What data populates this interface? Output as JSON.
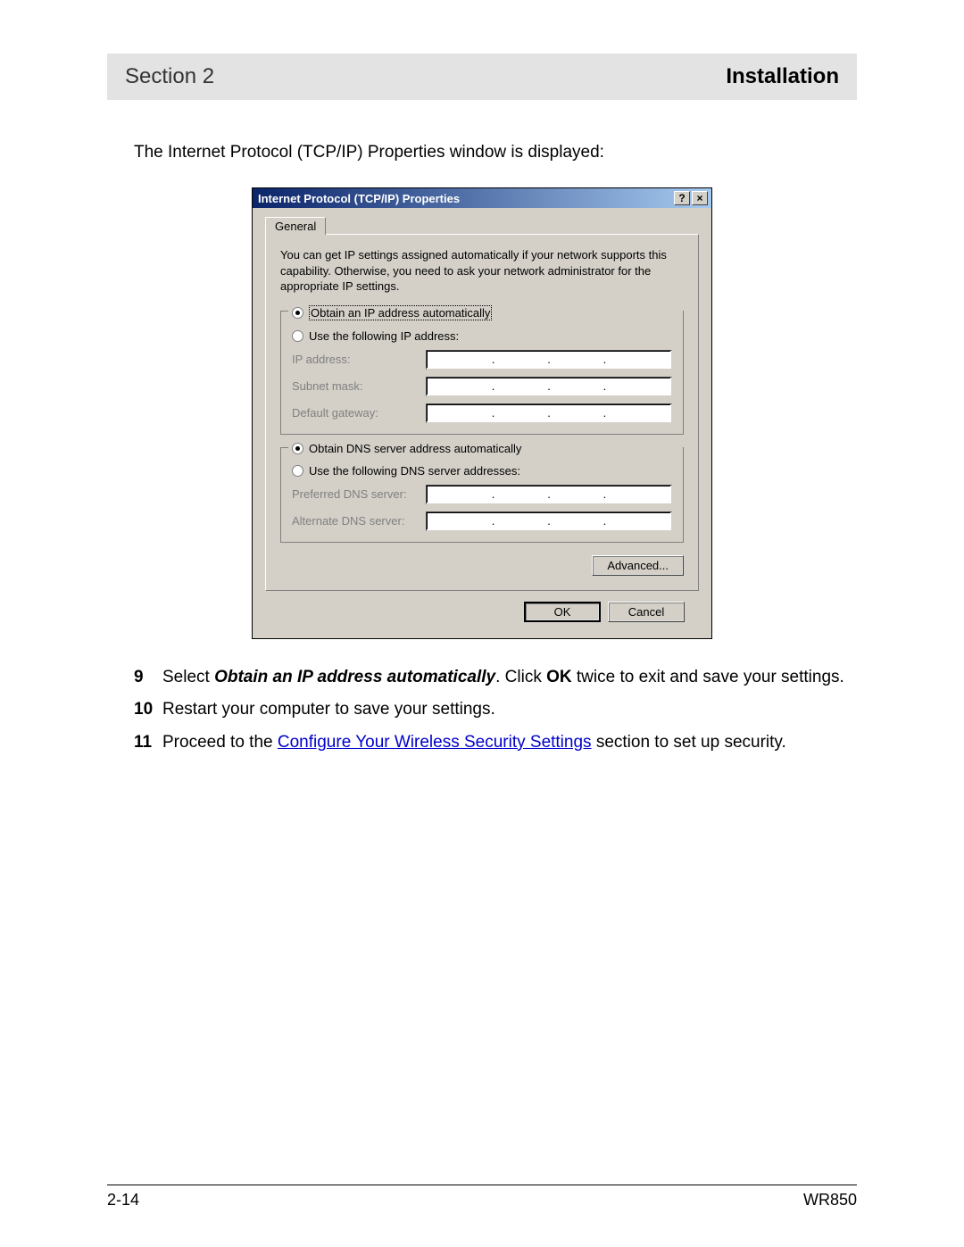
{
  "header": {
    "left": "Section 2",
    "right": "Installation"
  },
  "intro": "The Internet Protocol (TCP/IP) Properties window is displayed:",
  "dialog": {
    "title": "Internet Protocol (TCP/IP) Properties",
    "help_btn": "?",
    "close_btn": "×",
    "tab": "General",
    "desc": "You can get IP settings assigned automatically if your network supports this capability. Otherwise, you need to ask your network administrator for the appropriate IP settings.",
    "ip": {
      "auto": "Obtain an IP address automatically",
      "manual": "Use the following IP address:",
      "fields": {
        "ip": "IP address:",
        "subnet": "Subnet mask:",
        "gateway": "Default gateway:"
      }
    },
    "dns": {
      "auto": "Obtain DNS server address automatically",
      "manual": "Use the following DNS server addresses:",
      "fields": {
        "pref": "Preferred DNS server:",
        "alt": "Alternate DNS server:"
      }
    },
    "advanced": "Advanced...",
    "ok": "OK",
    "cancel": "Cancel"
  },
  "steps": [
    {
      "num": "9",
      "pre": "Select ",
      "bold1": "Obtain an IP address automatically",
      "mid": ". Click ",
      "bold2": "OK",
      "post": " twice to exit and save your settings."
    },
    {
      "num": "10",
      "text": "Restart your computer to save your settings."
    },
    {
      "num": "11",
      "pre": "Proceed to the ",
      "link": "Configure Your Wireless Security Settings",
      "post": " section to set up security."
    }
  ],
  "footer": {
    "left": "2-14",
    "right": "WR850"
  }
}
